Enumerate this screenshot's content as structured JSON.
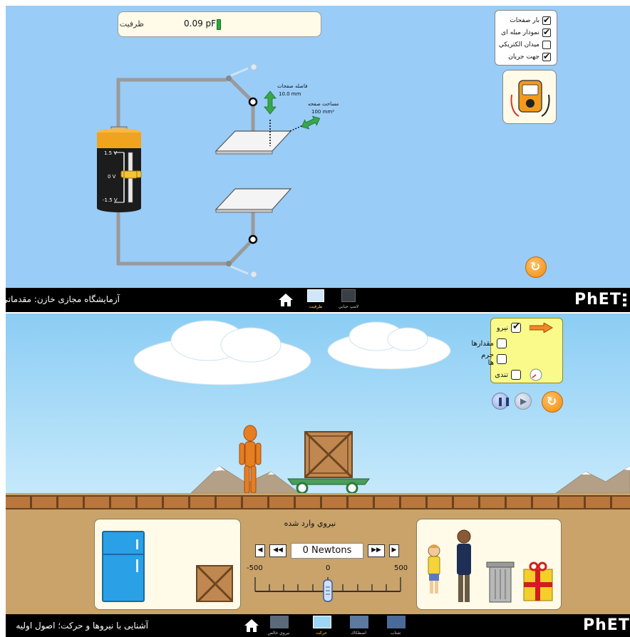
{
  "top_sim": {
    "capacitance_readout": {
      "label": "ظرفيت",
      "value": "0.09 pF"
    },
    "checkboxes": [
      {
        "label": "بار صفحات",
        "checked": true
      },
      {
        "label": "نمودار ميله اى",
        "checked": true
      },
      {
        "label": "ميدان الكتريكي",
        "checked": false
      },
      {
        "label": "جهت جريان",
        "checked": true
      }
    ],
    "battery": {
      "top": "1.5 V",
      "mid": "0 V",
      "bottom": "-1.5 V",
      "level": 0
    },
    "separation": {
      "label": "فاصله صفحات",
      "value": "10.0 mm"
    },
    "plate_area": {
      "label": "مساحت صفحه",
      "value": "100 mm²"
    },
    "nav": {
      "title": "آزمايشگاه مجازى خازن: مقدماتى",
      "tabs": [
        {
          "label": "ظرفيت",
          "selected": true
        },
        {
          "label": "لامپ حبابي",
          "selected": false
        }
      ],
      "brand_a": "PhET",
      "brand_i": ":"
    }
  },
  "bottom_sim": {
    "checkboxes": [
      {
        "label": "نيرو",
        "checked": true
      },
      {
        "label": "مقدارها",
        "checked": false
      },
      {
        "label": "جرم ها",
        "checked": false
      },
      {
        "label": "تندى",
        "checked": false
      }
    ],
    "applied_force": {
      "title": "نيروي وارد شده",
      "value": "0 Newtons",
      "min_label": "-500",
      "zero_label": "0",
      "max_label": "500",
      "slider_value": 0
    },
    "nav": {
      "title": "آشنايى با نيروها و حركت؛ اصول اوليه",
      "tabs": [
        {
          "label": "نيروي خالص",
          "selected": false
        },
        {
          "label": "حركت",
          "selected": true
        },
        {
          "label": "اصطكاك",
          "selected": false
        },
        {
          "label": "شتاب",
          "selected": false
        }
      ],
      "brand": "PhET"
    }
  }
}
